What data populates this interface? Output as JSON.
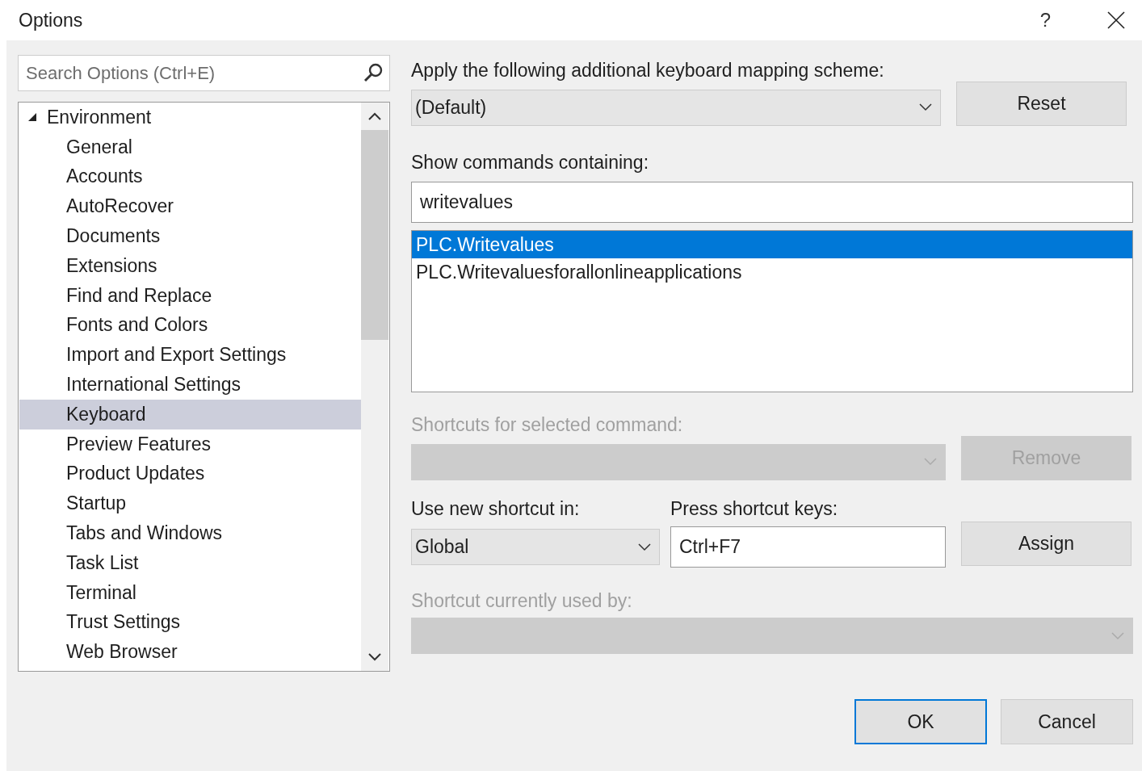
{
  "window": {
    "title": "Options",
    "help": "?"
  },
  "search": {
    "placeholder": "Search Options (Ctrl+E)"
  },
  "tree": [
    {
      "label": "Environment",
      "expanded": true,
      "children": [
        {
          "label": "General",
          "selected": false
        },
        {
          "label": "Accounts",
          "selected": false
        },
        {
          "label": "AutoRecover",
          "selected": false
        },
        {
          "label": "Documents",
          "selected": false
        },
        {
          "label": "Extensions",
          "selected": false
        },
        {
          "label": "Find and Replace",
          "selected": false
        },
        {
          "label": "Fonts and Colors",
          "selected": false
        },
        {
          "label": "Import and Export Settings",
          "selected": false
        },
        {
          "label": "International Settings",
          "selected": false
        },
        {
          "label": "Keyboard",
          "selected": true
        },
        {
          "label": "Preview Features",
          "selected": false
        },
        {
          "label": "Product Updates",
          "selected": false
        },
        {
          "label": "Startup",
          "selected": false
        },
        {
          "label": "Tabs and Windows",
          "selected": false
        },
        {
          "label": "Task List",
          "selected": false
        },
        {
          "label": "Terminal",
          "selected": false
        },
        {
          "label": "Trust Settings",
          "selected": false
        },
        {
          "label": "Web Browser",
          "selected": false
        }
      ]
    }
  ],
  "mapping_scheme": {
    "label": "Apply the following additional keyboard mapping scheme:",
    "value": "(Default)"
  },
  "reset_button": {
    "label": "Reset"
  },
  "show_commands": {
    "label": "Show commands containing:",
    "value": "writevalues"
  },
  "commands": [
    {
      "label": "PLC.Writevalues",
      "selected": true
    },
    {
      "label": "PLC.Writevaluesforallonlineapplications",
      "selected": false
    }
  ],
  "shortcuts_for_selected": {
    "label": "Shortcuts for selected command:",
    "disabled": true
  },
  "remove_button": {
    "label": "Remove",
    "disabled": true
  },
  "use_new_shortcut_in": {
    "label": "Use new shortcut in:",
    "value": "Global"
  },
  "press_shortcut_keys": {
    "label": "Press shortcut keys:",
    "value": "Ctrl+F7"
  },
  "assign_button": {
    "label": "Assign",
    "disabled": false
  },
  "shortcut_used_by": {
    "label": "Shortcut currently used by:",
    "disabled": true
  },
  "buttons": [
    {
      "label": "OK",
      "default": true
    },
    {
      "label": "Cancel",
      "default": false
    }
  ]
}
